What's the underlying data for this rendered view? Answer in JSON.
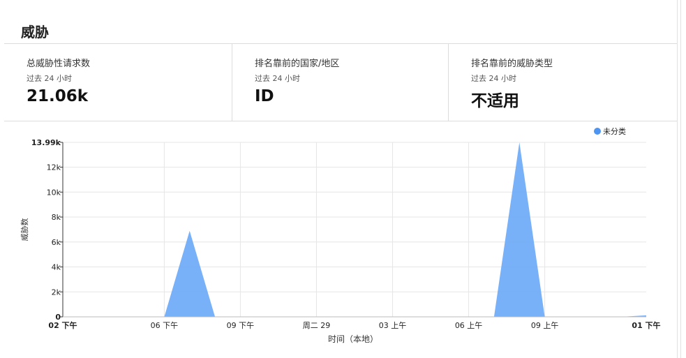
{
  "section_title": "威胁",
  "stats": [
    {
      "label": "总威胁性请求数",
      "sub": "过去 24 小时",
      "value": "21.06k"
    },
    {
      "label": "排名靠前的国家/地区",
      "sub": "过去 24 小时",
      "value": "ID"
    },
    {
      "label": "排名靠前的威胁类型",
      "sub": "过去 24 小时",
      "value": "不适用"
    }
  ],
  "chart_data": {
    "type": "area",
    "ylabel": "威胁数",
    "xlabel": "时间（本地）",
    "ylim": [
      0,
      13990
    ],
    "y_ticks": [
      {
        "v": 0,
        "label": "0",
        "bold": true
      },
      {
        "v": 2000,
        "label": "2k"
      },
      {
        "v": 4000,
        "label": "4k"
      },
      {
        "v": 6000,
        "label": "6k"
      },
      {
        "v": 8000,
        "label": "8k"
      },
      {
        "v": 10000,
        "label": "10k"
      },
      {
        "v": 12000,
        "label": "12k"
      },
      {
        "v": 13990,
        "label": "13.99k",
        "bold": true
      }
    ],
    "x_range": [
      0,
      23
    ],
    "x_ticks": [
      {
        "h": 0,
        "label": "02 下午",
        "bold": true
      },
      {
        "h": 4,
        "label": "06 下午"
      },
      {
        "h": 7,
        "label": "09 下午"
      },
      {
        "h": 10,
        "label": "周二 29"
      },
      {
        "h": 13,
        "label": "03 上午"
      },
      {
        "h": 16,
        "label": "06 上午"
      },
      {
        "h": 19,
        "label": "09 上午"
      },
      {
        "h": 23,
        "label": "01 下午",
        "bold": true
      }
    ],
    "series": [
      {
        "name": "未分类",
        "color": "#6aa8f7",
        "legend_color": "#4e95f2",
        "points": [
          [
            0,
            0
          ],
          [
            4,
            0
          ],
          [
            5,
            6900
          ],
          [
            6,
            0
          ],
          [
            17,
            0
          ],
          [
            18,
            13990
          ],
          [
            19,
            0
          ],
          [
            22,
            0
          ],
          [
            23,
            120
          ]
        ]
      }
    ],
    "legend_position": "top-right",
    "grid": true
  }
}
